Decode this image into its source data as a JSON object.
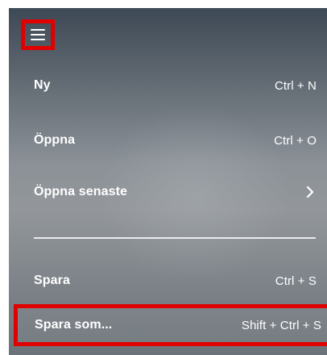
{
  "menu": {
    "toggle_icon": "hamburger-icon",
    "items": [
      {
        "label": "Ny",
        "shortcut": "Ctrl + N"
      },
      {
        "label": "Öppna",
        "shortcut": "Ctrl + O"
      },
      {
        "label": "Öppna senaste",
        "submenu_icon": "chevron-right-icon"
      },
      {
        "label": "Spara",
        "shortcut": "Ctrl + S"
      },
      {
        "label": "Spara som...",
        "shortcut": "Shift + Ctrl + S"
      }
    ]
  },
  "colors": {
    "highlight_box": "#e00000",
    "text": "#ffffff",
    "background_top": "#3d4955",
    "background_middle": "#93979b"
  }
}
